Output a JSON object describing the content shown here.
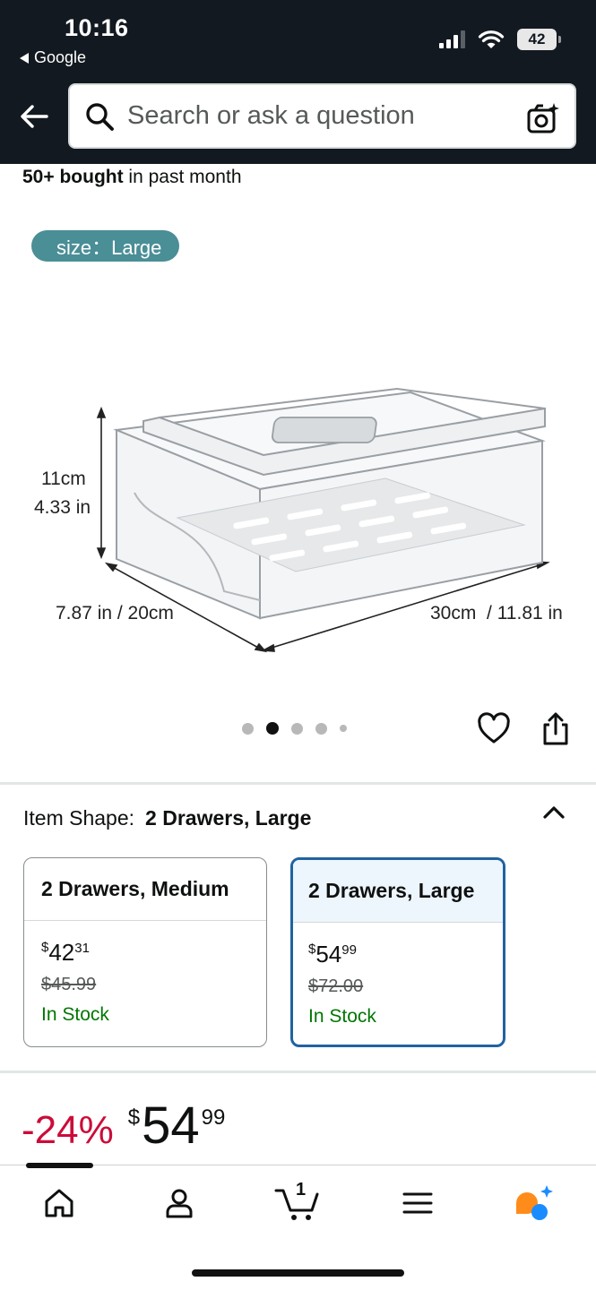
{
  "status_bar": {
    "time": "10:16",
    "back_app": "Google",
    "battery": "42"
  },
  "search": {
    "placeholder": "Search or ask a question"
  },
  "product": {
    "bought_count": "50+ bought",
    "bought_suffix": " in past month",
    "size_badge": "size：Large",
    "dimensions": {
      "height_cm": "11cm",
      "height_in": "4.33 in",
      "depth": "7.87 in / 20cm",
      "width": "30cm  / 11.81 in"
    },
    "image_count": 5,
    "active_image_index": 1
  },
  "item_shape": {
    "label": "Item Shape:",
    "selected": "2 Drawers, Large",
    "options": [
      {
        "title": "2 Drawers, Medium",
        "price_symbol": "$",
        "price_whole": "42",
        "price_fraction": "31",
        "list_price": "$45.99",
        "stock": "In Stock",
        "selected": false
      },
      {
        "title": "2 Drawers, Large",
        "price_symbol": "$",
        "price_whole": "54",
        "price_fraction": "99",
        "list_price": "$72.00",
        "stock": "In Stock",
        "selected": true
      }
    ]
  },
  "price": {
    "discount": "-24%",
    "symbol": "$",
    "whole": "54",
    "fraction": "99"
  },
  "bottom_nav": {
    "cart_count": "1",
    "items": [
      "home-icon",
      "account-icon",
      "cart-icon",
      "menu-icon",
      "rufus-assistant-icon"
    ]
  },
  "colors": {
    "header_bg": "#131921",
    "badge_teal": "#4a8e96",
    "selected_border": "#2162a1",
    "discount_red": "#cc0c39",
    "stock_green": "#007600",
    "assistant_orange": "#ff8c1a",
    "assistant_blue": "#1a8cff"
  }
}
